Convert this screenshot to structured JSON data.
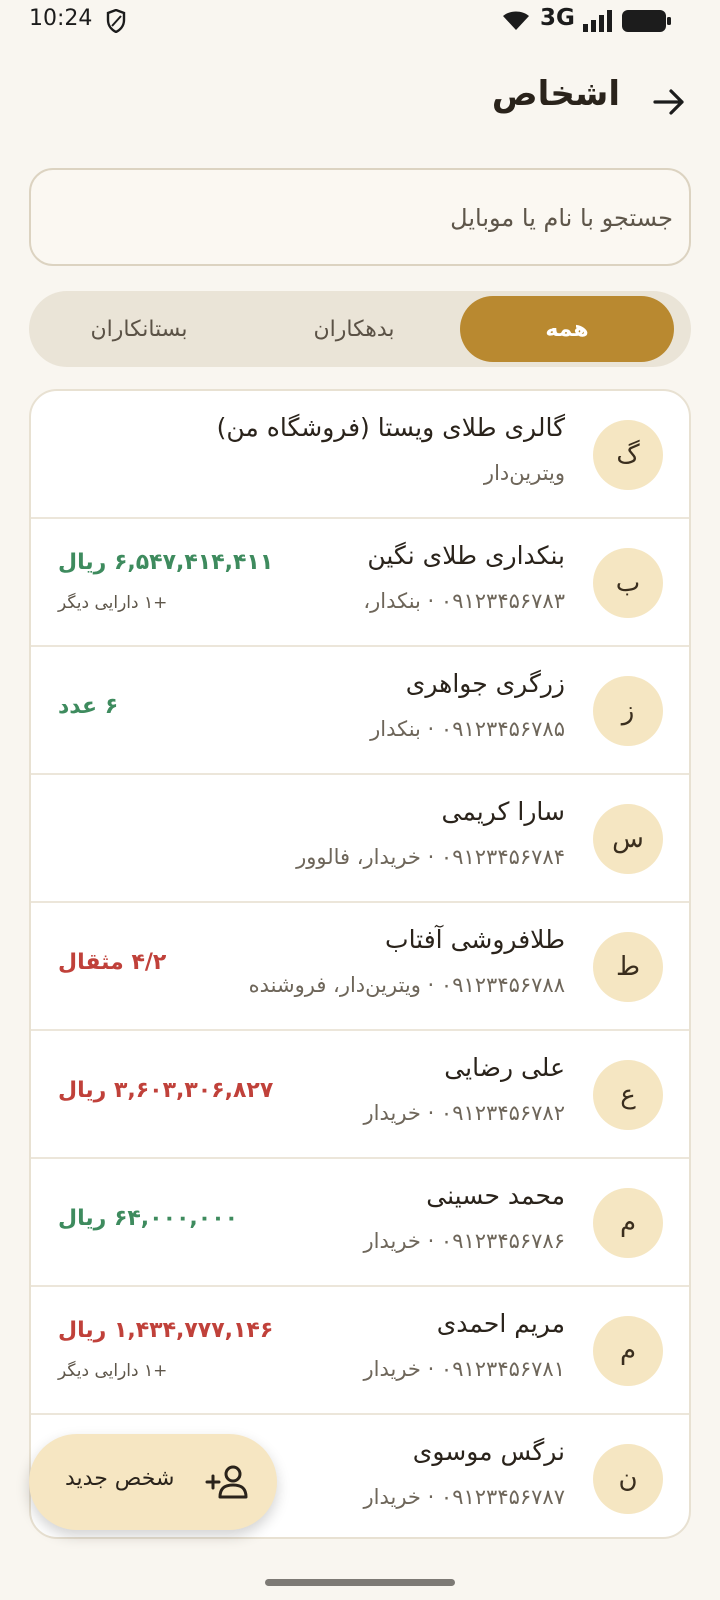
{
  "status": {
    "time": "10:24",
    "network": "3G"
  },
  "header": {
    "title": "اشخاص"
  },
  "search": {
    "placeholder": "جستجو با نام یا موبایل"
  },
  "tabs": [
    {
      "label": "همه",
      "active": true
    },
    {
      "label": "بدهکاران",
      "active": false
    },
    {
      "label": "بستانکاران",
      "active": false
    }
  ],
  "people": [
    {
      "initial": "گ",
      "name": "گالری طلای ویستا (فروشگاه من)",
      "subtitle": "ویترین‌دار",
      "amount": "",
      "extra": ""
    },
    {
      "initial": "ب",
      "name": "بنکداری طلای نگین",
      "subtitle": "۰۹۱۲۳۴۵۶۷۸۳ · بنکدار،",
      "amount": "۶,۵۴۷,۴۱۴,۴۱۱ ریال",
      "extra": "+۱ دارایی دیگر"
    },
    {
      "initial": "ز",
      "name": "زرگری جواهری",
      "subtitle": "۰۹۱۲۳۴۵۶۷۸۵ · بنکدار",
      "amount": "۶ عدد",
      "extra": ""
    },
    {
      "initial": "س",
      "name": "سارا کریمی",
      "subtitle": "۰۹۱۲۳۴۵۶۷۸۴ · خریدار، فالوور",
      "amount": "",
      "extra": ""
    },
    {
      "initial": "ط",
      "name": "طلافروشی آفتاب",
      "subtitle": "۰۹۱۲۳۴۵۶۷۸۸ · ویترین‌دار، فروشنده",
      "amount": "۴/۲ مثقال",
      "extra": ""
    },
    {
      "initial": "ع",
      "name": "علی رضایی",
      "subtitle": "۰۹۱۲۳۴۵۶۷۸۲ · خریدار",
      "amount": "۳,۶۰۳,۳۰۶,۸۲۷ ریال",
      "extra": ""
    },
    {
      "initial": "م",
      "name": "محمد حسینی",
      "subtitle": "۰۹۱۲۳۴۵۶۷۸۶ · خریدار",
      "amount": "۶۴,۰۰۰,۰۰۰ ریال",
      "extra": ""
    },
    {
      "initial": "م",
      "name": "مریم احمدی",
      "subtitle": "۰۹۱۲۳۴۵۶۷۸۱ · خریدار",
      "amount": "۱,۴۳۴,۷۷۷,۱۴۶ ریال",
      "extra": "+۱ دارایی دیگر"
    },
    {
      "initial": "ن",
      "name": "نرگس موسوی",
      "subtitle": "۰۹۱۲۳۴۵۶۷۸۷ · خریدار",
      "amount": "",
      "extra": ""
    }
  ],
  "fab": {
    "label": "شخص جدید"
  },
  "colors": {
    "accent": "#B98930",
    "positive": "#3E8B5E",
    "negative": "#C0413A",
    "avatar_bg": "#F5E6C2"
  }
}
